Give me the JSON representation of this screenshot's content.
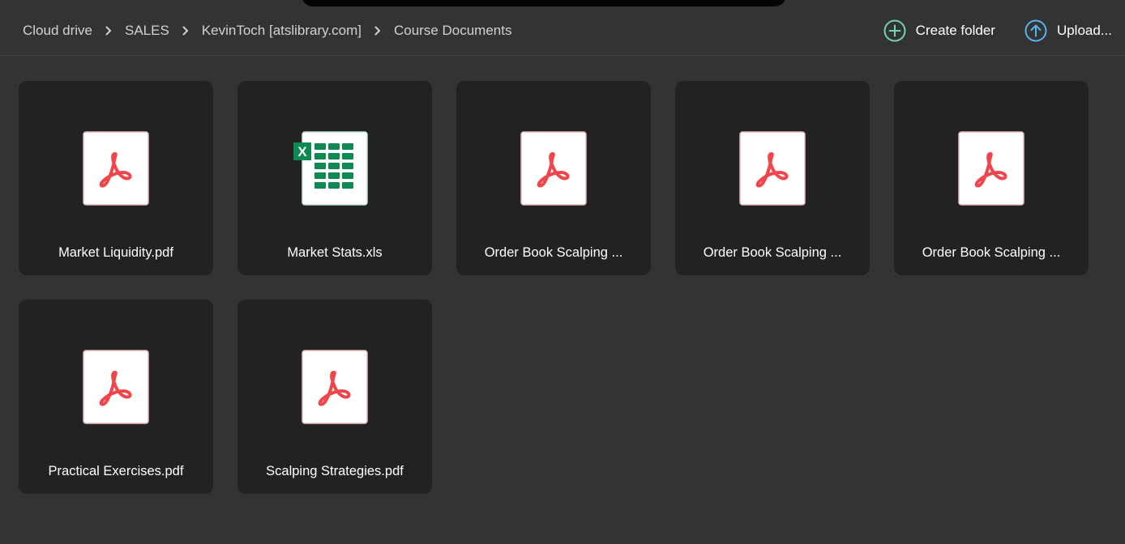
{
  "breadcrumb": [
    {
      "label": "Cloud drive"
    },
    {
      "label": "SALES"
    },
    {
      "label": "KevinToch [atslibrary.com]"
    },
    {
      "label": "Course Documents"
    }
  ],
  "actions": {
    "create_folder_label": "Create folder",
    "upload_label": "Upload..."
  },
  "colors": {
    "background": "#333333",
    "tile": "#222222",
    "pdf_red": "#f0454a",
    "excel_green": "#0e8a50",
    "create_accent": "#6fd6b0",
    "upload_accent": "#58b4ea"
  },
  "files": [
    {
      "name": "Market Liquidity.pdf",
      "icon": "pdf-icon"
    },
    {
      "name": "Market Stats.xls",
      "icon": "excel-icon",
      "icon_letter": "X"
    },
    {
      "name": "Order Book Scalping ...",
      "icon": "pdf-icon"
    },
    {
      "name": "Order Book Scalping ...",
      "icon": "pdf-icon"
    },
    {
      "name": "Order Book Scalping ...",
      "icon": "pdf-icon"
    },
    {
      "name": "Practical Exercises.pdf",
      "icon": "pdf-icon"
    },
    {
      "name": "Scalping Strategies.pdf",
      "icon": "pdf-icon"
    }
  ]
}
